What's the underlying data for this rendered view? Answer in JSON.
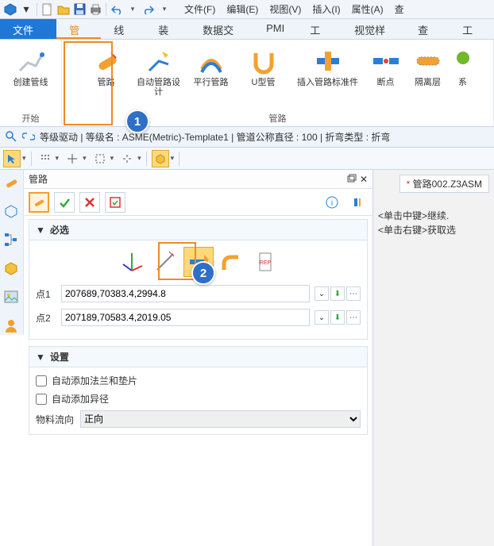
{
  "menus": {
    "file": "文件(F)",
    "edit": "编辑(E)",
    "view": "视图(V)",
    "insert": "插入(I)",
    "attr": "属性(A)",
    "query": "查"
  },
  "tabs": {
    "file": "文件(F)",
    "pipe": "管道",
    "wire": "线框",
    "assy": "装配",
    "data": "数据交换",
    "pmi": "PMI",
    "tool": "工具",
    "vstyle": "视觉样式",
    "query": "查询",
    "proj": "工程"
  },
  "ribbon": {
    "g1": "开始",
    "g2": "管路",
    "b1": "创建管线",
    "b2": "管路",
    "b3": "自动管路设计",
    "b4": "平行管路",
    "b5": "U型管",
    "b6": "插入管路标准件",
    "b7": "断点",
    "b8": "隔离层",
    "b9": "系"
  },
  "info_line": "等级驱动 | 等级名 : ASME(Metric)-Template1 | 管道公称直径 : 100 | 折弯类型 : 折弯",
  "panel": {
    "title": "管路",
    "req": "必选",
    "set": "设置",
    "p1": "点1",
    "p1v": "207689,70383.4,2994.8",
    "p2": "点2",
    "p2v": "207189,70583.4,2019.05",
    "chk1": "自动添加法兰和垫片",
    "chk2": "自动添加异径",
    "flow": "物料流向",
    "flowv": "正向"
  },
  "canvas": {
    "doc": "管路002.Z3ASM",
    "hint1": "<单击中键>继续.",
    "hint2": "<单击右键>获取选"
  },
  "steps": {
    "s1": "1",
    "s2": "2"
  }
}
